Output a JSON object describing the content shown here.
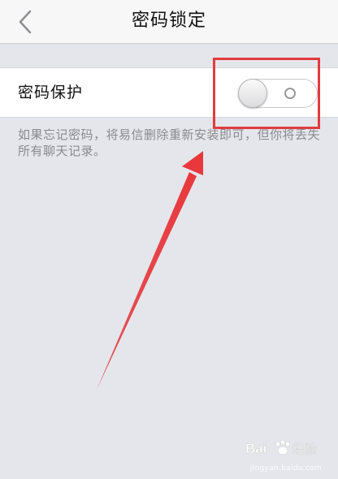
{
  "header": {
    "title": "密码锁定",
    "back_icon": "chevron-left-icon"
  },
  "settings": {
    "password_protection": {
      "label": "密码保护",
      "enabled": false
    },
    "hint": "如果忘记密码，将易信删除重新安装即可，但你将丢失所有聊天记录。"
  },
  "watermark": {
    "brand": "Bai 经验",
    "url": "jingyan.baidu.com"
  },
  "colors": {
    "background": "#e5e6eb",
    "nav_background": "#f7f7f8",
    "annotation_red": "#e23b3f",
    "hint_text": "#8a8a8e"
  }
}
